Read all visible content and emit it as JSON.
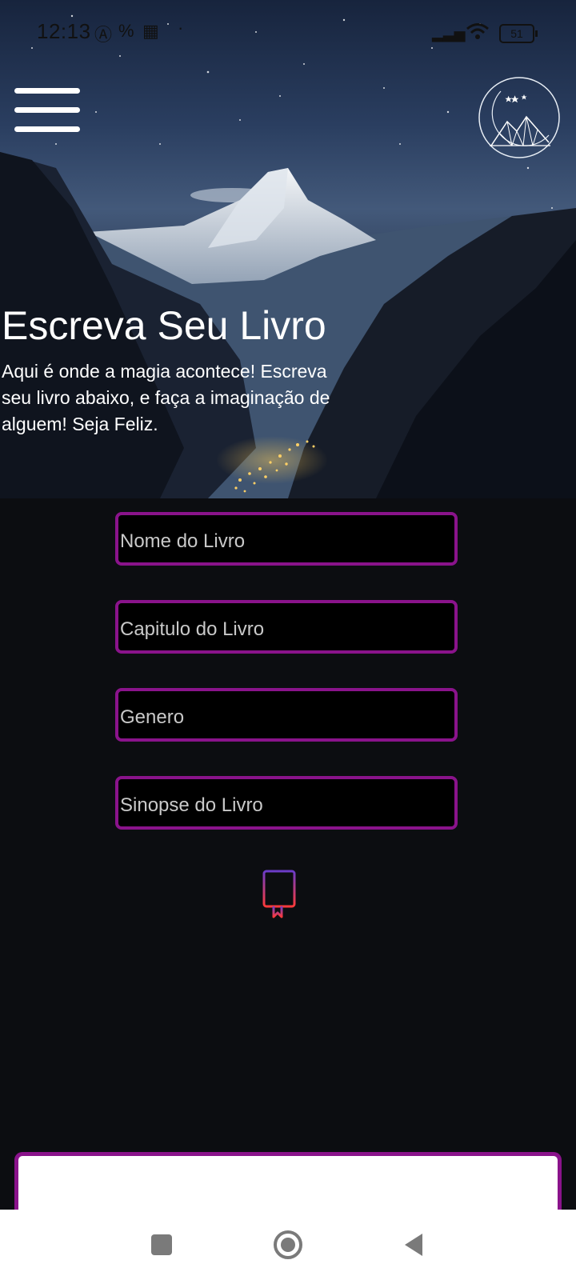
{
  "status_bar": {
    "time": "12:13",
    "battery": "51",
    "icons": [
      "a-icon",
      "percent-icon",
      "grid-icon",
      "signal-icon",
      "wifi-icon",
      "battery-icon"
    ]
  },
  "header": {
    "menu_icon": "hamburger-menu-icon",
    "logo_icon": "moon-mountain-logo-icon"
  },
  "hero": {
    "title": "Escreva Seu Livro",
    "subtitle": "Aqui é onde a magia acontece! Escreva seu livro abaixo, e faça a imaginação de alguem! Seja Feliz."
  },
  "form": {
    "book_name": {
      "placeholder": "Nome do Livro",
      "value": ""
    },
    "chapter": {
      "placeholder": "Capitulo do Livro",
      "value": ""
    },
    "genre": {
      "placeholder": "Genero",
      "value": ""
    },
    "synopsis": {
      "placeholder": "Sinopse do Livro",
      "value": ""
    },
    "submit_icon": "book-icon"
  },
  "colors": {
    "accent": "#8a138b",
    "background": "#0c0d11",
    "field_background": "#000000"
  },
  "navbar": {
    "icons": [
      "recents-square-icon",
      "home-circle-icon",
      "back-triangle-icon"
    ]
  }
}
